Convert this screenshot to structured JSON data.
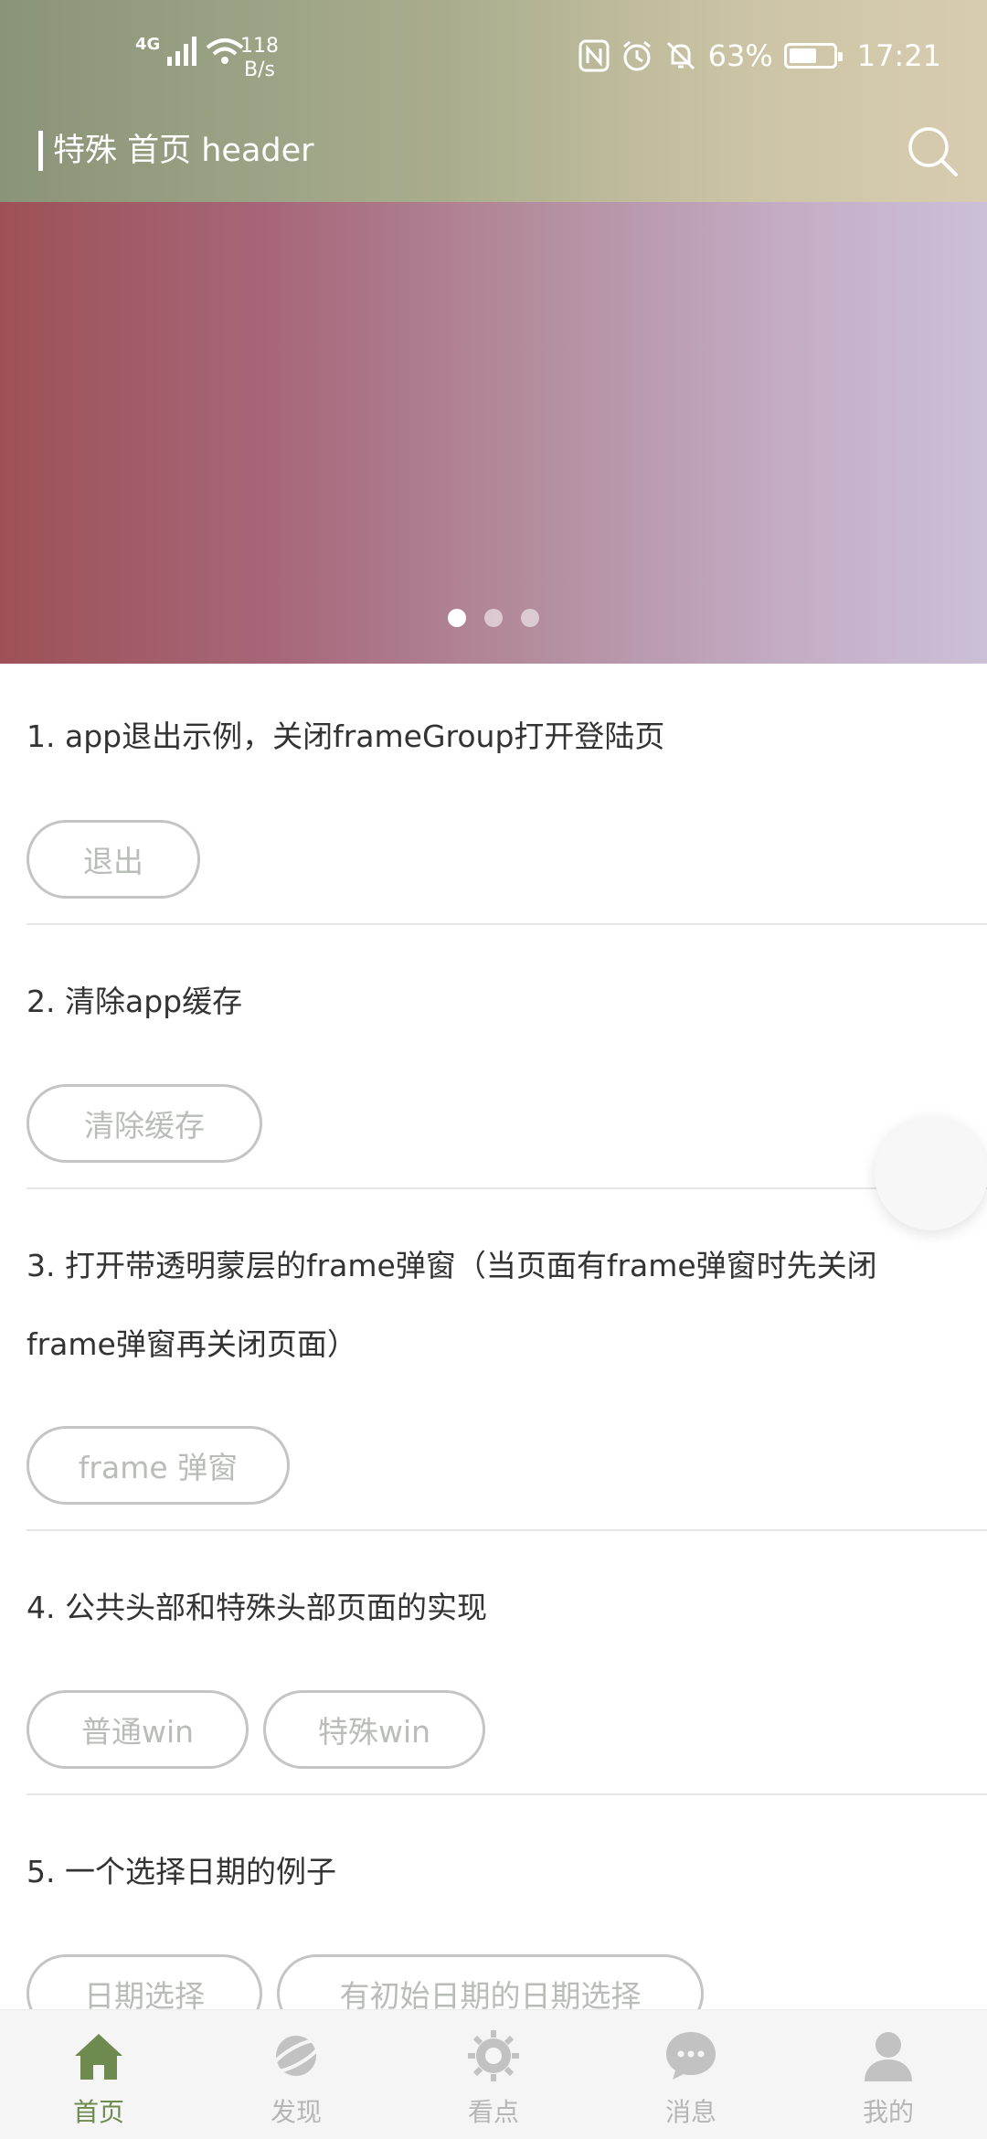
{
  "status_bar": {
    "network": "4G",
    "speed_value": "118",
    "speed_unit": "B/s",
    "battery": "63%",
    "battery_level": 0.63,
    "time": "17:21"
  },
  "header": {
    "title": "特殊 首页 header"
  },
  "banner": {
    "page_count": 3,
    "active_index": 0
  },
  "sections": [
    {
      "title": "1. app退出示例，关闭frameGroup打开登陆页",
      "buttons": [
        "退出"
      ]
    },
    {
      "title": "2. 清除app缓存",
      "buttons": [
        "清除缓存"
      ]
    },
    {
      "title_line1": "3. 打开带透明蒙层的frame弹窗（当页面有frame弹窗时先关闭",
      "title_line2": "frame弹窗再关闭页面）",
      "buttons": [
        "frame 弹窗"
      ]
    },
    {
      "title": "4. 公共头部和特殊头部页面的实现",
      "buttons": [
        "普通win",
        "特殊win"
      ]
    },
    {
      "title": "5. 一个选择日期的例子",
      "buttons": [
        "日期选择",
        "有初始日期的日期选择"
      ]
    }
  ],
  "tabbar": {
    "active": 0,
    "items": [
      {
        "label": "首页",
        "icon": "home-icon"
      },
      {
        "label": "发现",
        "icon": "planet-icon"
      },
      {
        "label": "看点",
        "icon": "sun-icon"
      },
      {
        "label": "消息",
        "icon": "chat-icon"
      },
      {
        "label": "我的",
        "icon": "user-icon"
      }
    ]
  },
  "colors": {
    "accent": "#6e8a4f",
    "inactive": "#b6b6b6",
    "button_border": "#c4c4c4",
    "button_text": "#b9bcb8"
  }
}
